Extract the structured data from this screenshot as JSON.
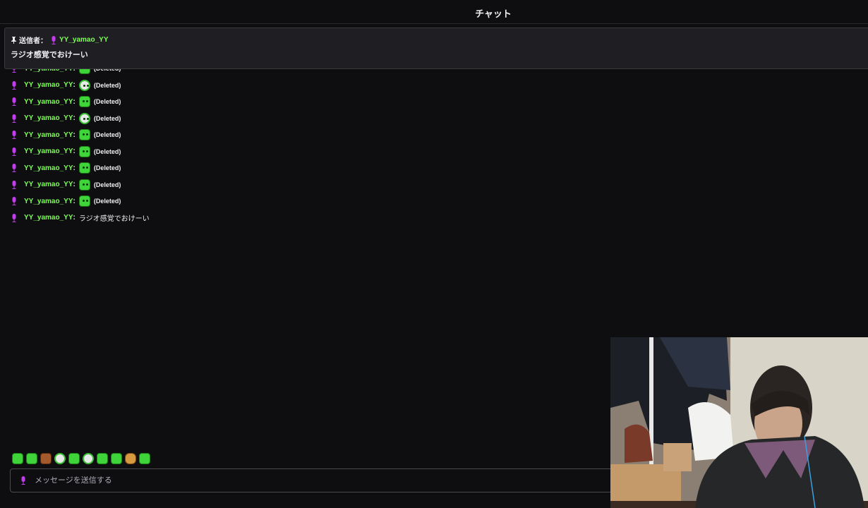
{
  "header": {
    "title": "チャット"
  },
  "pinned": {
    "label": "送信者：",
    "user": "YY_yamao_YY",
    "message": "ラジオ感覚でおけーい"
  },
  "chat": {
    "username": "YY_yamao_YY",
    "colon": ":",
    "deleted_text": "(Deleted)",
    "lines": [
      {
        "emote": "green",
        "msg": "(Deleted)"
      },
      {
        "emote": "face",
        "msg": "(Deleted)"
      },
      {
        "emote": "green",
        "msg": "(Deleted)"
      },
      {
        "emote": "face",
        "msg": "(Deleted)"
      },
      {
        "emote": "green",
        "msg": "(Deleted)"
      },
      {
        "emote": "green",
        "msg": "(Deleted)"
      },
      {
        "emote": "green",
        "msg": "(Deleted)"
      },
      {
        "emote": "green",
        "msg": "(Deleted)"
      },
      {
        "emote": "green",
        "msg": "(Deleted)"
      }
    ],
    "last_message": "ラジオ感覚でおけーい"
  },
  "emote_bar": [
    "green",
    "green",
    "brown",
    "face",
    "green",
    "face",
    "green",
    "green",
    "burger",
    "green"
  ],
  "input": {
    "placeholder": "メッセージを送信する"
  },
  "colors": {
    "username": "#7dff57",
    "mic": "#c43cf0",
    "background": "#0e0e10"
  }
}
